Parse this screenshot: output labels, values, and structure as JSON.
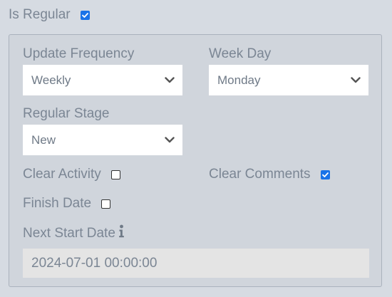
{
  "is_regular": {
    "label": "Is Regular",
    "checked": true
  },
  "panel": {
    "update_frequency": {
      "label": "Update Frequency",
      "value": "Weekly"
    },
    "week_day": {
      "label": "Week Day",
      "value": "Monday"
    },
    "regular_stage": {
      "label": "Regular Stage",
      "value": "New"
    },
    "clear_activity": {
      "label": "Clear Activity",
      "checked": false
    },
    "clear_comments": {
      "label": "Clear Comments",
      "checked": true
    },
    "finish_date": {
      "label": "Finish Date",
      "checked": false
    },
    "next_start_date": {
      "label": "Next Start Date",
      "value": "2024-07-01 00:00:00",
      "icon": "info-icon"
    }
  },
  "colors": {
    "background": "#d6dbe2",
    "panel": "#d0d5dc",
    "text": "#7b8694",
    "checkbox_accent": "#1a73e8",
    "readonly_field": "#e4e4e4"
  }
}
